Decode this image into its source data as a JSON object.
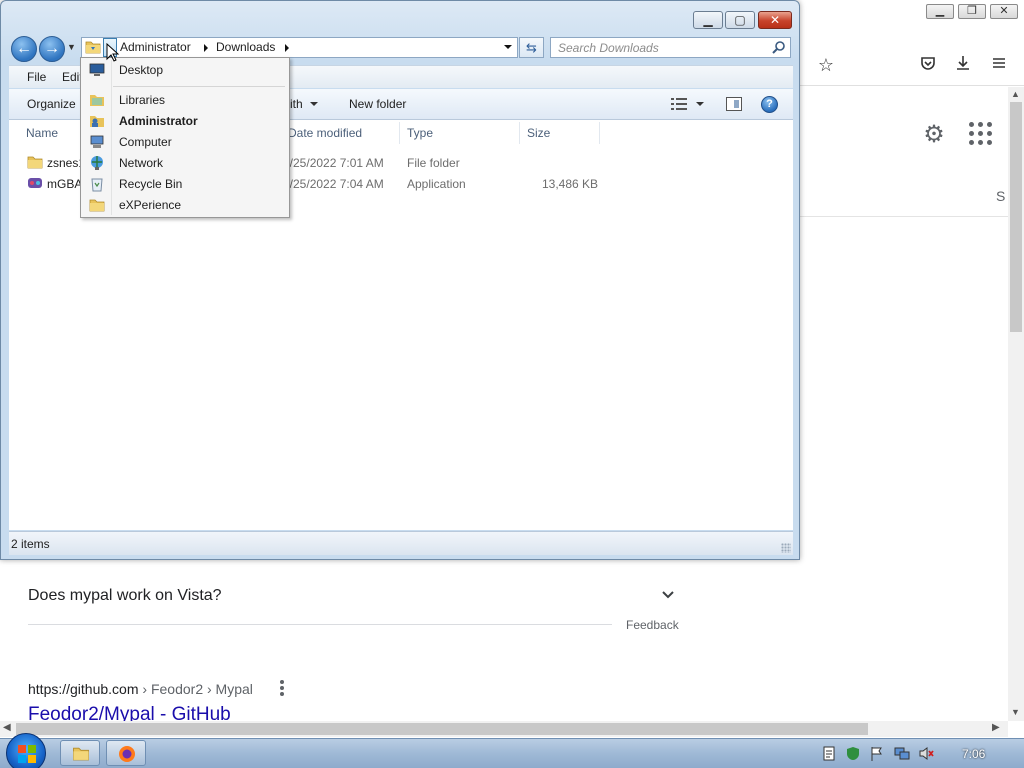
{
  "explorer": {
    "window_controls": {
      "minimize": "▁",
      "maximize": "▢",
      "close": "✕"
    },
    "breadcrumb": [
      "Administrator",
      "Downloads"
    ],
    "search_placeholder": "Search Downloads",
    "menubar": {
      "file": "File",
      "edit": "Edit"
    },
    "commandbar": {
      "organize": "Organize",
      "share_with_partial": "ith",
      "new_folder": "New folder"
    },
    "columns": {
      "name": "Name",
      "date_modified": "Date modified",
      "type": "Type",
      "size": "Size"
    },
    "rows": [
      {
        "name": "zsnes1",
        "date": "6/25/2022 7:01 AM",
        "type": "File folder",
        "size": ""
      },
      {
        "name": "mGBA",
        "date": "6/25/2022 7:04 AM",
        "type": "Application",
        "size": "13,486 KB"
      }
    ],
    "status": "2 items"
  },
  "dropdown": {
    "items": [
      {
        "label": "Desktop",
        "icon": "desktop-icon",
        "bold": false
      },
      {
        "label": "Libraries",
        "icon": "libraries-icon",
        "bold": false
      },
      {
        "label": "Administrator",
        "icon": "user-folder-icon",
        "bold": true
      },
      {
        "label": "Computer",
        "icon": "computer-icon",
        "bold": false
      },
      {
        "label": "Network",
        "icon": "network-icon",
        "bold": false
      },
      {
        "label": "Recycle Bin",
        "icon": "recycle-bin-icon",
        "bold": false
      },
      {
        "label": "eXPerience",
        "icon": "folder-icon",
        "bold": false
      }
    ]
  },
  "browser": {
    "faq_question": "Does mypal work on Vista?",
    "feedback": "Feedback",
    "result_host": "https://github.com",
    "result_path": " › Feodor2 › Mypal",
    "result_title": "Feodor2/Mypal - GitHub",
    "cut_letter": "S"
  },
  "taskbar": {
    "clock": "7:06"
  },
  "colors": {
    "accent_blue": "#2f74c0",
    "close_red": "#c8432b",
    "link_blue": "#1a0dab"
  }
}
